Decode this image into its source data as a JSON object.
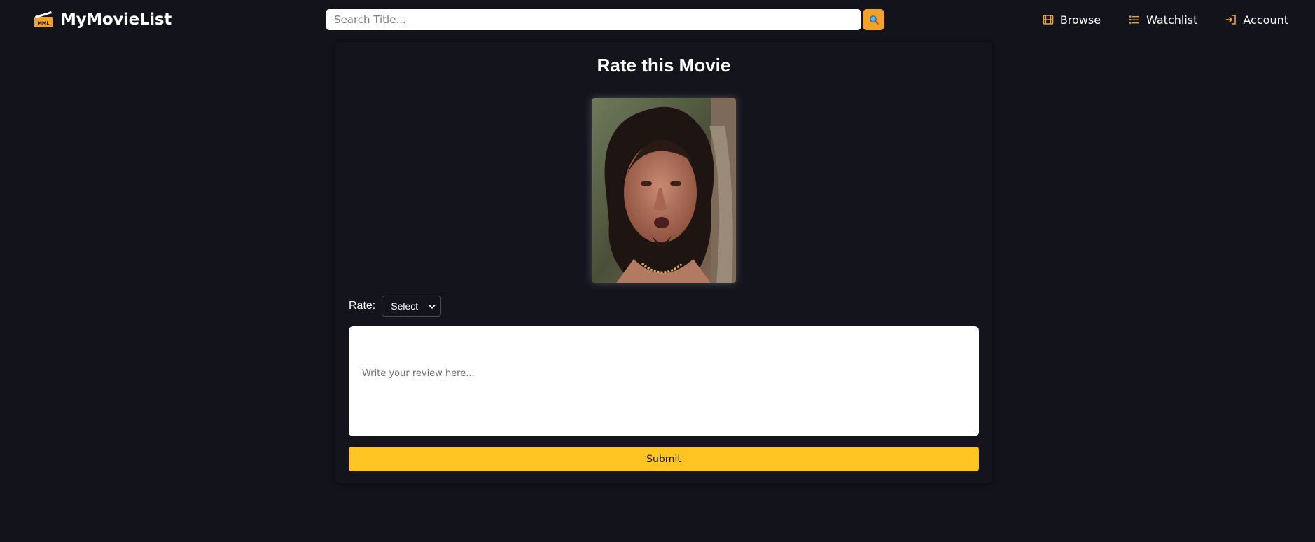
{
  "brand": {
    "name": "MyMovieList",
    "logo_mark_text": "MML",
    "accent": "#f0a22a"
  },
  "search": {
    "placeholder": "Search Title...",
    "value": "",
    "button_icon": "magnifier-icon"
  },
  "nav": {
    "items": [
      {
        "label": "Browse",
        "icon": "film-icon"
      },
      {
        "label": "Watchlist",
        "icon": "list-icon"
      },
      {
        "label": "Account",
        "icon": "sign-in-icon"
      }
    ]
  },
  "rating_card": {
    "title": "Rate this Movie",
    "rate_label": "Rate:",
    "rate_selected": "Select",
    "review_placeholder": "Write your review here...",
    "review_value": "",
    "submit_label": "Submit",
    "submit_color": "#fdc422"
  },
  "colors": {
    "page_background": "#13131c",
    "card_background": "#14141d"
  }
}
